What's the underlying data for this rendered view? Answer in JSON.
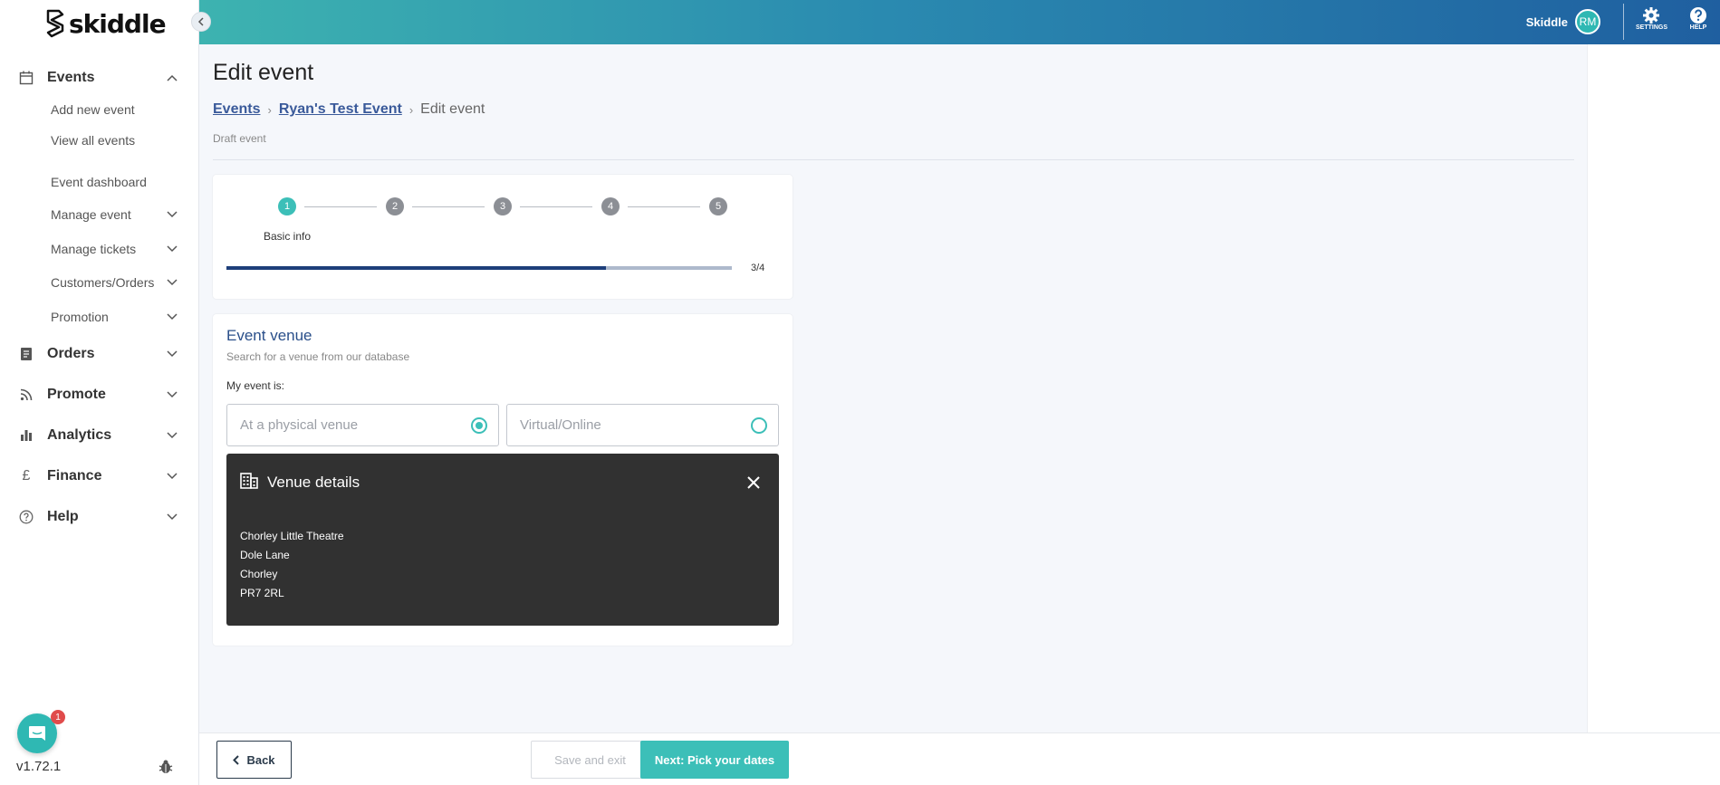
{
  "brand": {
    "logo_text": "skiddle"
  },
  "topbar": {
    "user_name": "Skiddle",
    "avatar_initials": "RM",
    "settings_label": "SETTINGS",
    "help_label": "HELP"
  },
  "sidebar": {
    "events": {
      "label": "Events",
      "items": [
        {
          "label": "Add new event"
        },
        {
          "label": "View all events"
        },
        {
          "label": "Event dashboard"
        },
        {
          "label": "Manage event"
        },
        {
          "label": "Manage tickets"
        },
        {
          "label": "Customers/Orders"
        },
        {
          "label": "Promotion"
        }
      ]
    },
    "sections": [
      {
        "label": "Orders"
      },
      {
        "label": "Promote"
      },
      {
        "label": "Analytics"
      },
      {
        "label": "Finance"
      },
      {
        "label": "Help"
      }
    ],
    "version": "v1.72.1",
    "chat_badge": "1"
  },
  "main": {
    "title": "Edit event",
    "breadcrumb": {
      "events": "Events",
      "event_name": "Ryan's Test Event",
      "current": "Edit event"
    },
    "status": "Draft event"
  },
  "stepper": {
    "steps": [
      "1",
      "2",
      "3",
      "4",
      "5"
    ],
    "active_step_label": "Basic info",
    "progress_fraction": 0.75,
    "progress_text": "3/4"
  },
  "venue": {
    "title": "Event venue",
    "subtitle": "Search for a venue from our database",
    "my_event_label": "My event is:",
    "option_physical": "At a physical venue",
    "option_virtual": "Virtual/Online",
    "selected": "physical",
    "details": {
      "title": "Venue details",
      "lines": [
        "Chorley Little Theatre",
        "Dole Lane",
        "Chorley",
        "PR7 2RL"
      ]
    }
  },
  "footer": {
    "back_label": "Back",
    "save_label": "Save and exit",
    "next_label": "Next: Pick your dates"
  },
  "colors": {
    "accent": "#3cbfb8",
    "navy": "#1e3f7a",
    "venue_panel": "#313131"
  }
}
